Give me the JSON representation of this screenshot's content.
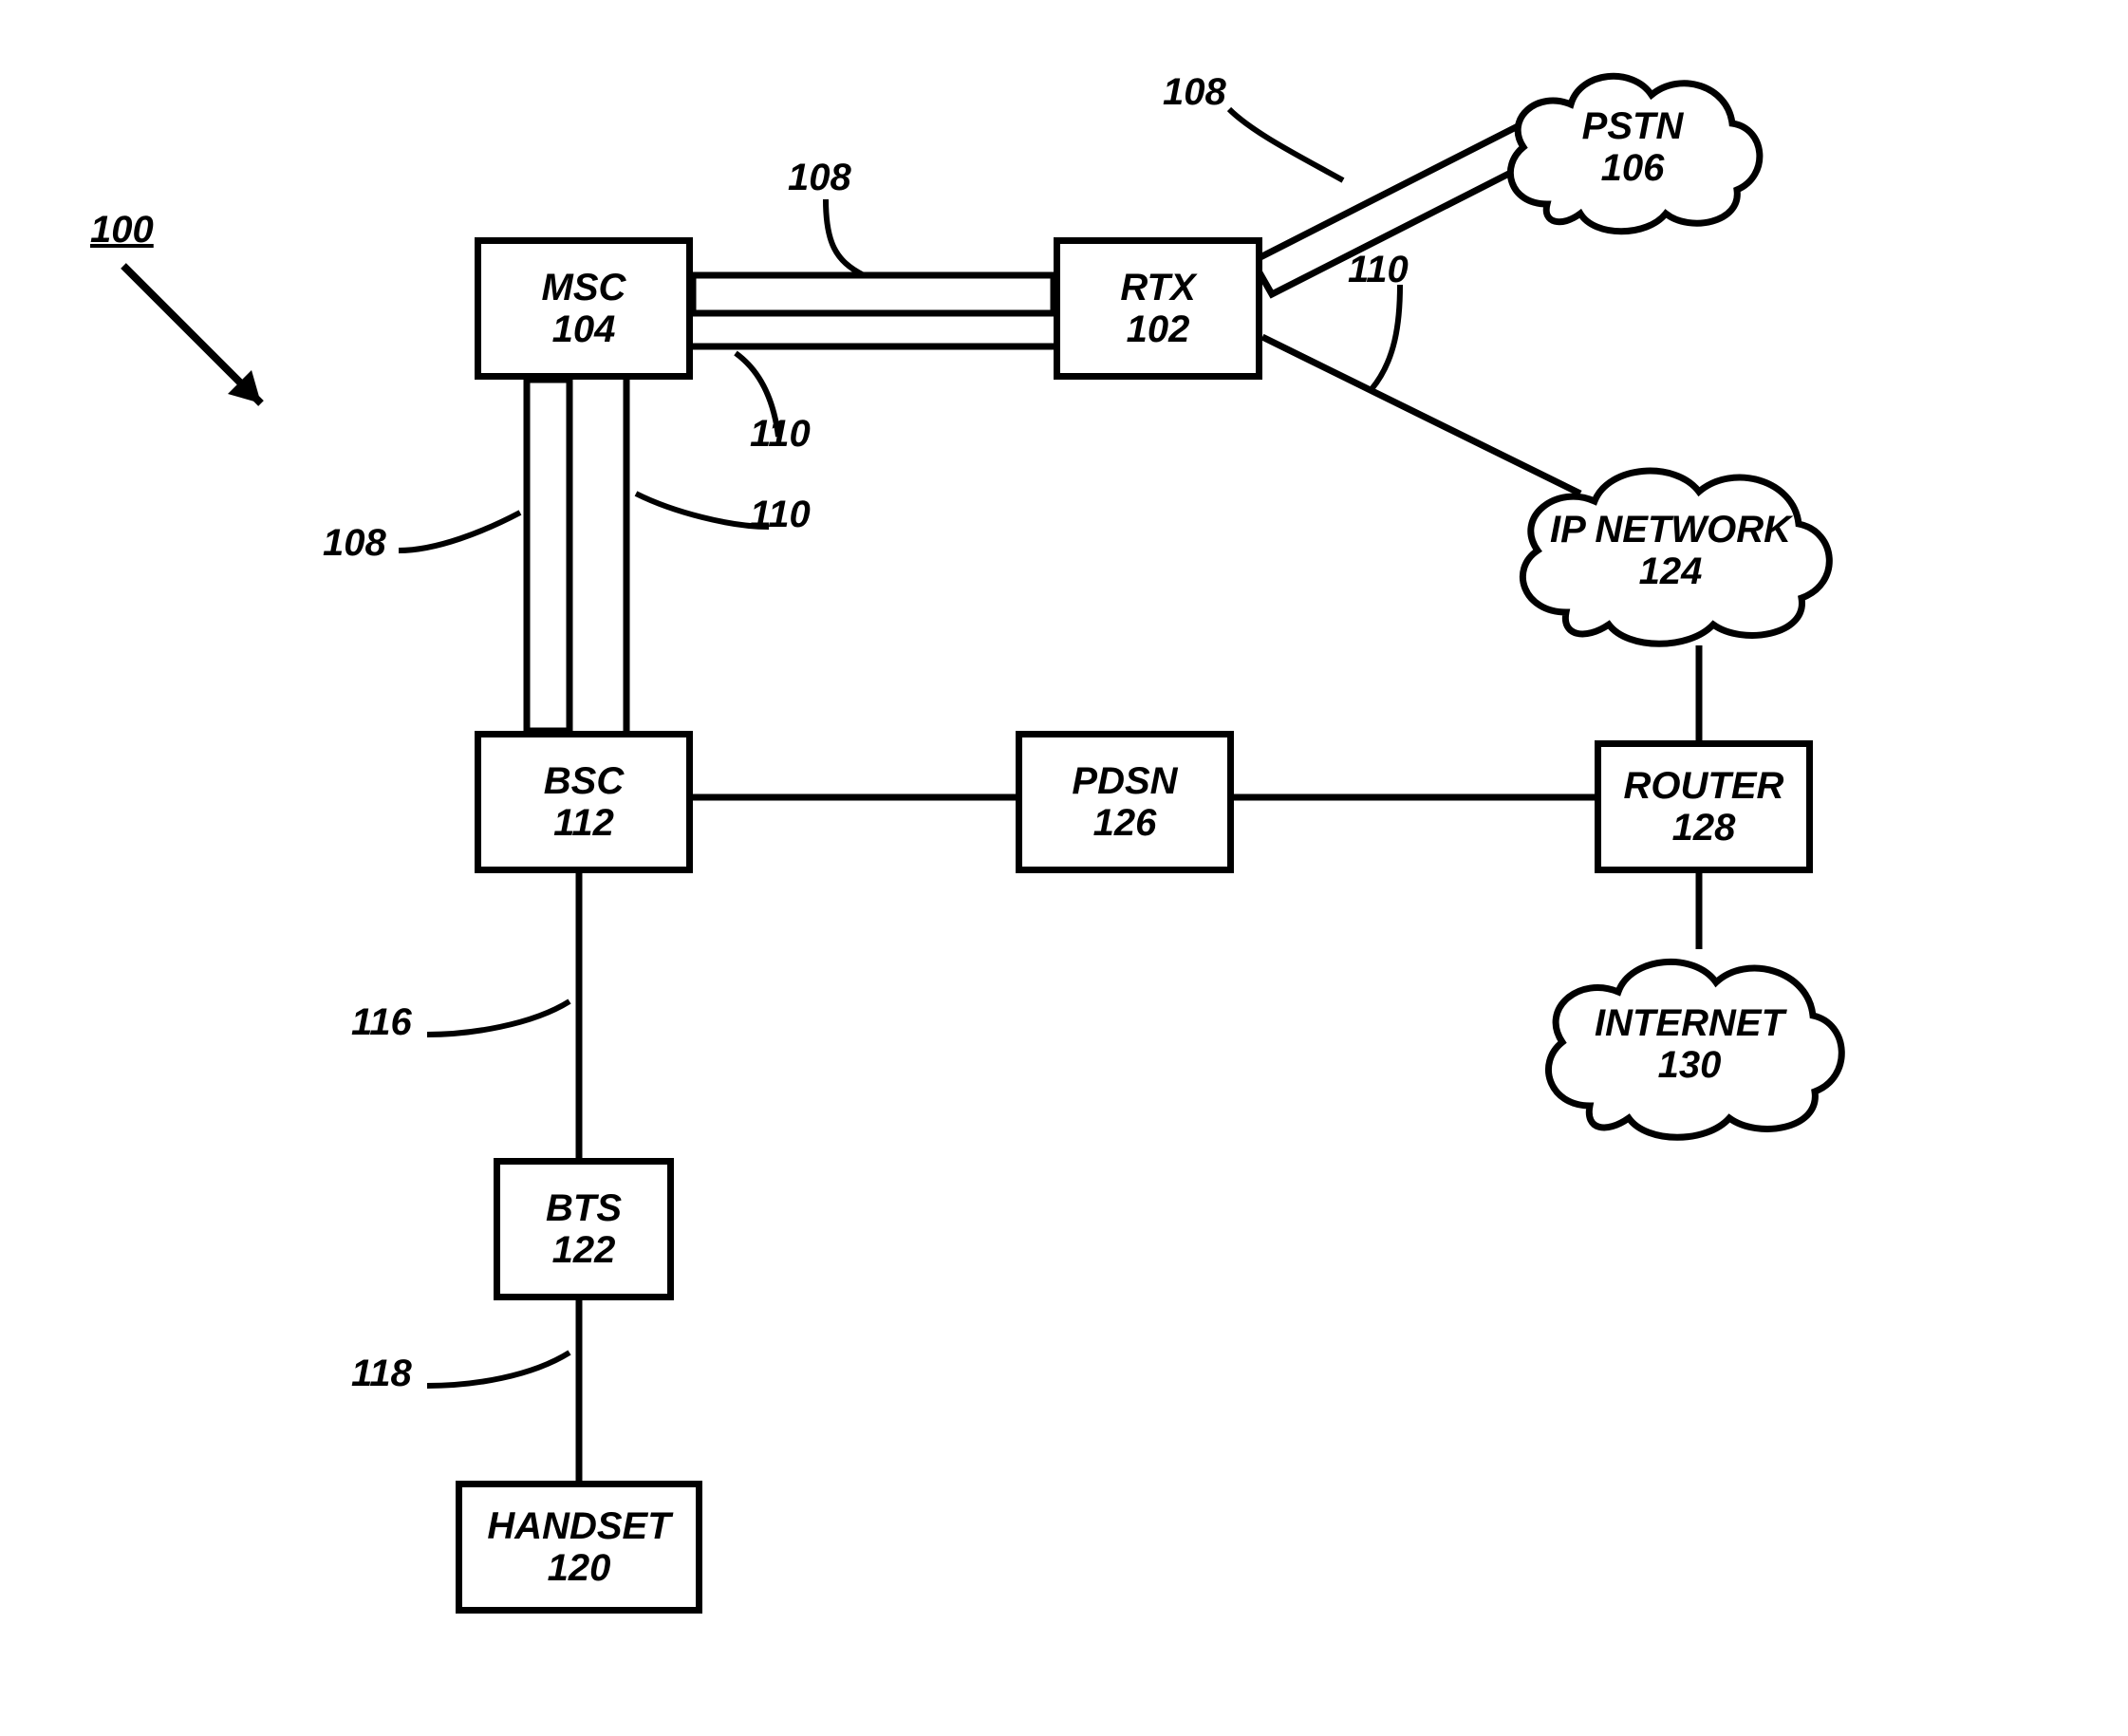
{
  "figure_ref": {
    "id": "100"
  },
  "nodes": {
    "msc": {
      "name": "MSC",
      "num": "104"
    },
    "rtx": {
      "name": "RTX",
      "num": "102"
    },
    "bsc": {
      "name": "BSC",
      "num": "112"
    },
    "pdsn": {
      "name": "PDSN",
      "num": "126"
    },
    "router": {
      "name": "ROUTER",
      "num": "128"
    },
    "bts": {
      "name": "BTS",
      "num": "122"
    },
    "handset": {
      "name": "HANDSET",
      "num": "120"
    },
    "pstn": {
      "name": "PSTN",
      "num": "106"
    },
    "ipnet": {
      "name": "IP NETWORK",
      "num": "124"
    },
    "internet": {
      "name": "INTERNET",
      "num": "130"
    }
  },
  "edge_labels": {
    "l108a": "108",
    "l108b": "108",
    "l108c": "108",
    "l110a": "110",
    "l110b": "110",
    "l110c": "110",
    "l116": "116",
    "l118": "118"
  }
}
